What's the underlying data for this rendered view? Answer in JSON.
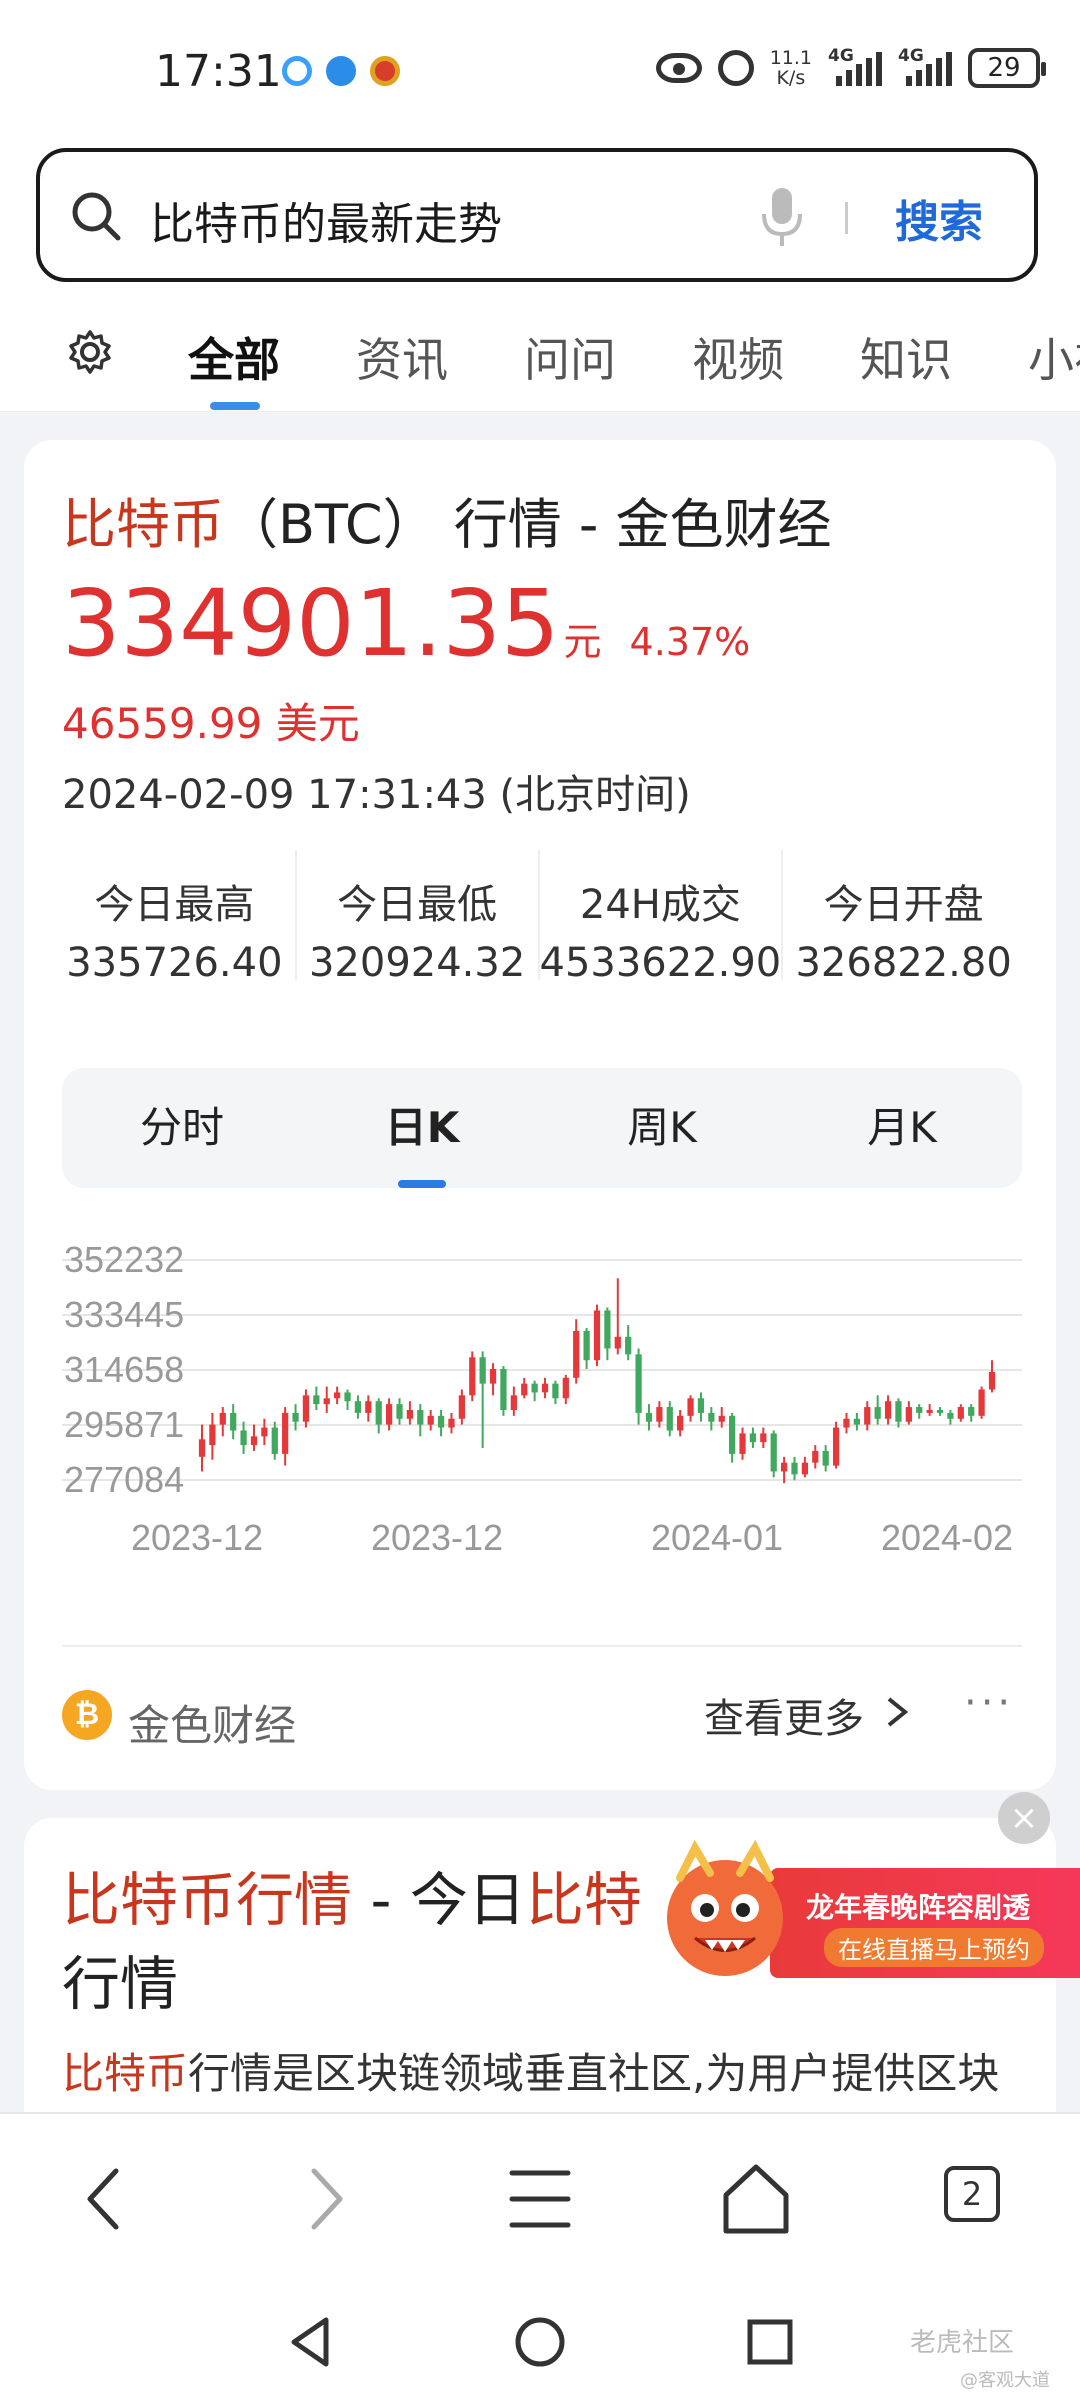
{
  "status_bar": {
    "time": "17:31",
    "net_speed_value": "11.1",
    "net_speed_unit": "K/s",
    "signal1_label": "4G",
    "signal2_label": "4G",
    "battery": "29",
    "icons": [
      "app-notification-icon",
      "app-notification-icon",
      "app-notification-icon",
      "eye-icon",
      "alarm-icon",
      "signal-icon",
      "battery-icon"
    ]
  },
  "search": {
    "query": "比特币的最新走势",
    "button_label": "搜索"
  },
  "tabs": {
    "items": [
      "全部",
      "资讯",
      "问问",
      "视频",
      "知识",
      "小视"
    ],
    "active_index": 0
  },
  "btc_card": {
    "title_highlight": "比特币",
    "title_rest": "（BTC） 行情 - 金色财经",
    "price": "334901.35",
    "price_unit": "元",
    "change_pct": "4.37%",
    "usd_price": "46559.99 美元",
    "updated": "2024-02-09 17:31:43 (北京时间)",
    "stats": [
      {
        "label": "今日最高",
        "value": "335726.40"
      },
      {
        "label": "今日最低",
        "value": "320924.32"
      },
      {
        "label": "24H成交",
        "value": "4533622.90"
      },
      {
        "label": "今日开盘",
        "value": "326822.80"
      }
    ],
    "kline_tabs": [
      "分时",
      "日K",
      "周K",
      "月K"
    ],
    "kline_active_index": 1,
    "source_name": "金色财经",
    "more_label": "查看更多",
    "more_dots": "···",
    "colors": {
      "up": "#e5383b",
      "down": "#41a85f",
      "price": "#e03131",
      "highlight": "#c8361d",
      "accent": "#1f6ad8"
    }
  },
  "chart_data": {
    "type": "candlestick",
    "y_ticks": [
      "352232",
      "333445",
      "314658",
      "295871",
      "277084"
    ],
    "ylim": [
      277084,
      352232
    ],
    "x_ticks": [
      "2023-12",
      "2023-12",
      "2024-01",
      "2024-02"
    ],
    "grid": true,
    "candles": [
      {
        "o": 285000,
        "c": 291000,
        "h": 296000,
        "l": 280000
      },
      {
        "o": 289000,
        "c": 296000,
        "h": 300000,
        "l": 284000
      },
      {
        "o": 296000,
        "c": 300000,
        "h": 302000,
        "l": 292000
      },
      {
        "o": 300000,
        "c": 294000,
        "h": 303000,
        "l": 291000
      },
      {
        "o": 294000,
        "c": 289000,
        "h": 297000,
        "l": 286000
      },
      {
        "o": 289000,
        "c": 292000,
        "h": 296000,
        "l": 287000
      },
      {
        "o": 292000,
        "c": 295000,
        "h": 298000,
        "l": 289000
      },
      {
        "o": 295000,
        "c": 286000,
        "h": 297000,
        "l": 284000
      },
      {
        "o": 286000,
        "c": 300000,
        "h": 302000,
        "l": 282000
      },
      {
        "o": 300000,
        "c": 297000,
        "h": 303000,
        "l": 294000
      },
      {
        "o": 297000,
        "c": 306000,
        "h": 308000,
        "l": 295000
      },
      {
        "o": 306000,
        "c": 303000,
        "h": 309000,
        "l": 301000
      },
      {
        "o": 303000,
        "c": 305000,
        "h": 309000,
        "l": 300000
      },
      {
        "o": 305000,
        "c": 307000,
        "h": 309000,
        "l": 303000
      },
      {
        "o": 307000,
        "c": 304000,
        "h": 308000,
        "l": 301000
      },
      {
        "o": 304000,
        "c": 300000,
        "h": 306000,
        "l": 298000
      },
      {
        "o": 300000,
        "c": 304000,
        "h": 306000,
        "l": 297000
      },
      {
        "o": 304000,
        "c": 296000,
        "h": 305000,
        "l": 293000
      },
      {
        "o": 296000,
        "c": 303000,
        "h": 305000,
        "l": 294000
      },
      {
        "o": 303000,
        "c": 298000,
        "h": 305000,
        "l": 296000
      },
      {
        "o": 298000,
        "c": 301000,
        "h": 304000,
        "l": 296000
      },
      {
        "o": 301000,
        "c": 296000,
        "h": 303000,
        "l": 292000
      },
      {
        "o": 296000,
        "c": 299000,
        "h": 301000,
        "l": 294000
      },
      {
        "o": 299000,
        "c": 295000,
        "h": 301000,
        "l": 292000
      },
      {
        "o": 295000,
        "c": 298000,
        "h": 300000,
        "l": 293000
      },
      {
        "o": 298000,
        "c": 306000,
        "h": 308000,
        "l": 296000
      },
      {
        "o": 306000,
        "c": 319000,
        "h": 321000,
        "l": 304000
      },
      {
        "o": 319000,
        "c": 310000,
        "h": 321000,
        "l": 288000
      },
      {
        "o": 310000,
        "c": 315000,
        "h": 317000,
        "l": 306000
      },
      {
        "o": 315000,
        "c": 301000,
        "h": 316000,
        "l": 299000
      },
      {
        "o": 301000,
        "c": 306000,
        "h": 309000,
        "l": 299000
      },
      {
        "o": 306000,
        "c": 310000,
        "h": 312000,
        "l": 305000
      },
      {
        "o": 310000,
        "c": 307000,
        "h": 311000,
        "l": 304000
      },
      {
        "o": 307000,
        "c": 310000,
        "h": 312000,
        "l": 305000
      },
      {
        "o": 310000,
        "c": 305000,
        "h": 311000,
        "l": 303000
      },
      {
        "o": 305000,
        "c": 312000,
        "h": 313000,
        "l": 303000
      },
      {
        "o": 312000,
        "c": 328000,
        "h": 332000,
        "l": 310000
      },
      {
        "o": 328000,
        "c": 318000,
        "h": 329000,
        "l": 315000
      },
      {
        "o": 318000,
        "c": 335000,
        "h": 337000,
        "l": 316000
      },
      {
        "o": 335000,
        "c": 322000,
        "h": 336000,
        "l": 318000
      },
      {
        "o": 322000,
        "c": 326000,
        "h": 346000,
        "l": 320000
      },
      {
        "o": 326000,
        "c": 320000,
        "h": 330000,
        "l": 318000
      },
      {
        "o": 320000,
        "c": 300000,
        "h": 322000,
        "l": 296000
      },
      {
        "o": 300000,
        "c": 297000,
        "h": 303000,
        "l": 294000
      },
      {
        "o": 297000,
        "c": 302000,
        "h": 304000,
        "l": 295000
      },
      {
        "o": 302000,
        "c": 294000,
        "h": 304000,
        "l": 292000
      },
      {
        "o": 294000,
        "c": 299000,
        "h": 301000,
        "l": 292000
      },
      {
        "o": 299000,
        "c": 305000,
        "h": 306000,
        "l": 297000
      },
      {
        "o": 305000,
        "c": 300000,
        "h": 307000,
        "l": 297000
      },
      {
        "o": 300000,
        "c": 297000,
        "h": 302000,
        "l": 294000
      },
      {
        "o": 297000,
        "c": 299000,
        "h": 302000,
        "l": 295000
      },
      {
        "o": 299000,
        "c": 286000,
        "h": 300000,
        "l": 283000
      },
      {
        "o": 286000,
        "c": 293000,
        "h": 295000,
        "l": 284000
      },
      {
        "o": 293000,
        "c": 290000,
        "h": 295000,
        "l": 288000
      },
      {
        "o": 290000,
        "c": 293000,
        "h": 295000,
        "l": 288000
      },
      {
        "o": 293000,
        "c": 280000,
        "h": 294000,
        "l": 278000
      },
      {
        "o": 280000,
        "c": 283000,
        "h": 285000,
        "l": 276000
      },
      {
        "o": 283000,
        "c": 279000,
        "h": 285000,
        "l": 277000
      },
      {
        "o": 279000,
        "c": 283000,
        "h": 285000,
        "l": 278000
      },
      {
        "o": 283000,
        "c": 287000,
        "h": 289000,
        "l": 281000
      },
      {
        "o": 287000,
        "c": 282000,
        "h": 289000,
        "l": 280000
      },
      {
        "o": 282000,
        "c": 295000,
        "h": 297000,
        "l": 281000
      },
      {
        "o": 295000,
        "c": 298000,
        "h": 300000,
        "l": 293000
      },
      {
        "o": 298000,
        "c": 296000,
        "h": 300000,
        "l": 294000
      },
      {
        "o": 296000,
        "c": 302000,
        "h": 304000,
        "l": 294000
      },
      {
        "o": 302000,
        "c": 298000,
        "h": 306000,
        "l": 296000
      },
      {
        "o": 298000,
        "c": 304000,
        "h": 306000,
        "l": 296000
      },
      {
        "o": 304000,
        "c": 297000,
        "h": 305000,
        "l": 295000
      },
      {
        "o": 297000,
        "c": 302000,
        "h": 304000,
        "l": 296000
      },
      {
        "o": 302000,
        "c": 300000,
        "h": 303000,
        "l": 298000
      },
      {
        "o": 300000,
        "c": 301000,
        "h": 303000,
        "l": 299000
      },
      {
        "o": 301000,
        "c": 300000,
        "h": 302000,
        "l": 299000
      },
      {
        "o": 300000,
        "c": 298000,
        "h": 301000,
        "l": 296000
      },
      {
        "o": 298000,
        "c": 302000,
        "h": 303000,
        "l": 297000
      },
      {
        "o": 302000,
        "c": 299000,
        "h": 303000,
        "l": 297000
      },
      {
        "o": 299000,
        "c": 308000,
        "h": 309000,
        "l": 298000
      },
      {
        "o": 308000,
        "c": 314000,
        "h": 318000,
        "l": 307000
      }
    ]
  },
  "result2": {
    "title_hl1": "比特币行情",
    "title_mid": " - 今日",
    "title_hl2": "比特",
    "title_line2": "行情",
    "snippet_hl": "比特币",
    "snippet_rest": "行情是区块链领域垂直社区,为用户提供区块"
  },
  "ad": {
    "line1": "龙年春晚阵容剧透",
    "line2": "在线直播马上预约",
    "close_label": "×"
  },
  "browser_bar": {
    "tab_count": "2"
  },
  "watermark": {
    "line1": "老虎社区",
    "line2": "@客观大道"
  }
}
